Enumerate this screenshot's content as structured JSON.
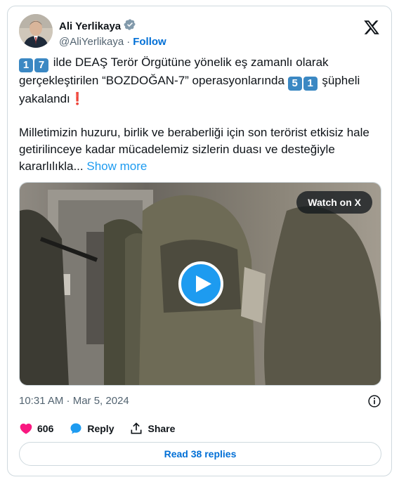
{
  "author": {
    "name": "Ali Yerlikaya",
    "handle": "@AliYerlikaya",
    "separator": "·",
    "follow_label": "Follow"
  },
  "tweet": {
    "p1_n1a": "1",
    "p1_n1b": "7",
    "p1_text": " ilde DEAŞ Terör Örgütüne yönelik eş zamanlı olarak gerçekleştirilen “BOZDOĞAN-7” operasyonlarında ",
    "p1_n2a": "5",
    "p1_n2b": "1",
    "p1_text2": " şüpheli yakalandı",
    "p1_excl": "❗",
    "p2_text": "Milletimizin huzuru, birlik ve beraberliği için son terörist etkisiz hale getirilinceye kadar mücadelemiz sizlerin duası ve desteğiyle kararlılıkla... ",
    "show_more": "Show more"
  },
  "media": {
    "watch_label": "Watch on X"
  },
  "timestamp": "10:31 AM · Mar 5, 2024",
  "actions": {
    "likes": "606",
    "reply_label": "Reply",
    "share_label": "Share"
  },
  "read_replies": "Read 38 replies",
  "colors": {
    "accent": "#1d9bf0",
    "link": "#006fd6",
    "like": "#f91880",
    "text_secondary": "#536471"
  }
}
